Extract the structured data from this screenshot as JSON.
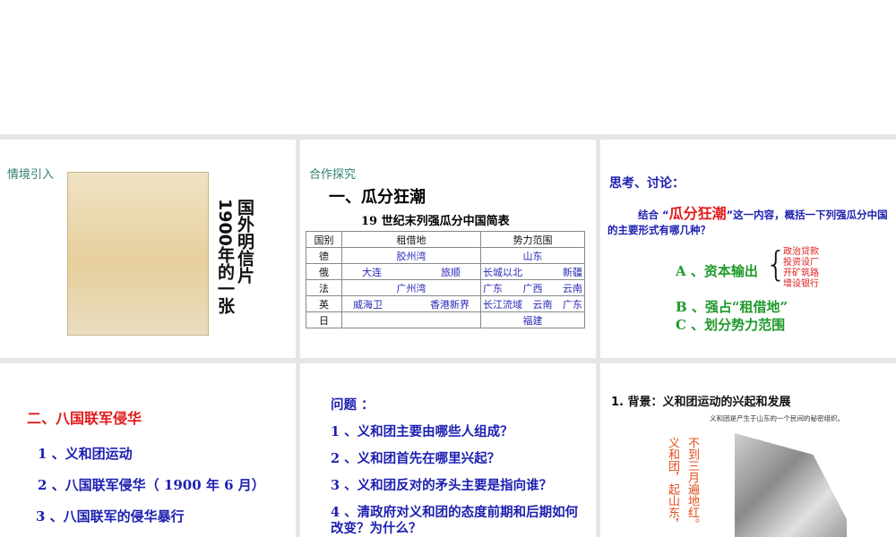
{
  "slides": [
    {
      "label": "情境引入",
      "caption": "国外明信片",
      "caption2": "1900年的一张",
      "image": "postcard-image"
    },
    {
      "label": "合作探究",
      "title": "一、瓜分狂潮",
      "table_title": "19 世纪末列强瓜分中国简表",
      "headers": [
        "国别",
        "租借地",
        "势力范围"
      ],
      "rows": [
        {
          "country": "德",
          "lease": [
            "胶州湾"
          ],
          "sphere": [
            "山东"
          ]
        },
        {
          "country": "俄",
          "lease": [
            "大连",
            "旅顺"
          ],
          "sphere": [
            "长城以北",
            "新疆"
          ]
        },
        {
          "country": "法",
          "lease": [
            "广州湾"
          ],
          "sphere": [
            "广东",
            "广西",
            "云南"
          ]
        },
        {
          "country": "英",
          "lease": [
            "威海卫",
            "香港新界"
          ],
          "sphere": [
            "长江流域",
            "云南",
            "广东"
          ]
        },
        {
          "country": "日",
          "lease": [],
          "sphere": [
            "福建"
          ]
        }
      ]
    },
    {
      "title": "思考、讨论：",
      "q_pre": "结合 “",
      "q_hl": "瓜分狂潮",
      "q_post": "”这一内容，概括一下列强瓜分中国的主要形式有哪几种？",
      "a": "A 、资本输出",
      "a_items": [
        "政治贷款",
        "投资设厂",
        "开矿筑路",
        "增设银行"
      ],
      "b": "B 、强占“租借地”",
      "c": "C 、划分势力范围"
    },
    {
      "title": "二、八国联军侵华",
      "items": [
        "1 、义和团运动",
        "2 、八国联军侵华（ 1900 年 6 月）",
        "3 、八国联军的侵华暴行"
      ]
    },
    {
      "title": "问题 ：",
      "items": [
        "1 、义和团主要由哪些人组成？",
        "2 、义和团首先在哪里兴起？",
        "3 、义和团反对的矛头主要是指向谁？",
        "4 、清政府对义和团的态度前期和后期如何改变？为什么？"
      ]
    },
    {
      "title": "1. 背景：义和团运动的兴起和发展",
      "note": "义和团是产生于山东的一个民间的秘密组织。",
      "verse1": "不到三月遍地红。",
      "verse2": "义和团，起山东，"
    }
  ]
}
